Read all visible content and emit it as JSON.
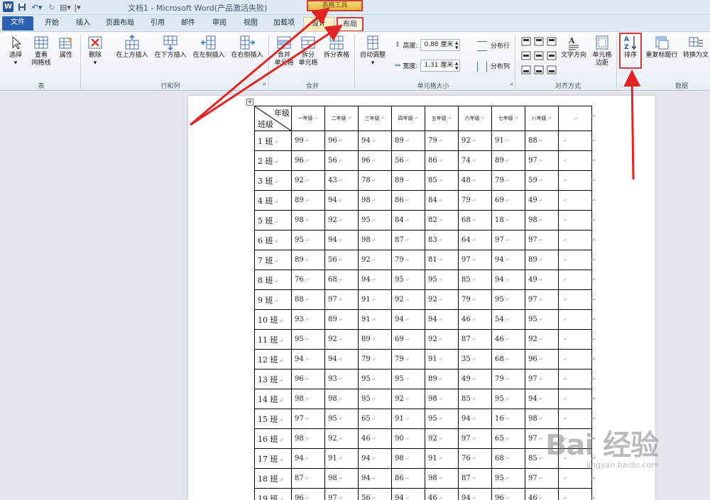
{
  "titlebar": {
    "title": "文档1 - Microsoft Word(产品激活失败)",
    "context_tab_group": "表格工具"
  },
  "tabs": [
    "文件",
    "开始",
    "插入",
    "页面布局",
    "引用",
    "邮件",
    "审阅",
    "视图",
    "加载项",
    "设计",
    "布局"
  ],
  "ribbon": {
    "table_group": {
      "select": "选择",
      "gridlines_line1": "查看",
      "gridlines_line2": "网格线",
      "properties": "属性",
      "label": "表"
    },
    "rows_cols_group": {
      "delete": "删除",
      "insert_above": "在上方插入",
      "insert_below": "在下方插入",
      "insert_left": "在左侧插入",
      "insert_right": "在右侧插入",
      "label": "行和列"
    },
    "merge_group": {
      "merge_line1": "合并",
      "merge_line2": "单元格",
      "split_line1": "拆分",
      "split_line2": "单元格",
      "split_table": "拆分表格",
      "label": "合并"
    },
    "cell_size_group": {
      "autofit": "自动调整",
      "height_label": "高度:",
      "height_value": "0.88 厘米",
      "width_label": "宽度:",
      "width_value": "1.31 厘米",
      "distribute_rows": "分布行",
      "distribute_cols": "分布列",
      "label": "单元格大小"
    },
    "alignment_group": {
      "text_direction": "文字方向",
      "cell_margins_line1": "单元格",
      "cell_margins_line2": "边距",
      "label": "对齐方式"
    },
    "data_group": {
      "sort": "排序",
      "repeat_header": "重复标题行",
      "convert_text": "转换为文",
      "label": "数据"
    }
  },
  "document_table": {
    "header_top": "年级",
    "header_bottom": "班级",
    "columns": [
      "一年级",
      "二年级",
      "三年级",
      "四年级",
      "五年级",
      "六年级",
      "七年级",
      "八年级",
      ""
    ],
    "rows": [
      {
        "name": "1 班",
        "values": [
          "99",
          "96",
          "94",
          "89",
          "79",
          "92",
          "91",
          "88"
        ]
      },
      {
        "name": "2 班",
        "values": [
          "96",
          "56",
          "96",
          "56",
          "86",
          "74",
          "89",
          "97"
        ]
      },
      {
        "name": "3 班",
        "values": [
          "92",
          "43",
          "78",
          "89",
          "85",
          "48",
          "79",
          "59"
        ]
      },
      {
        "name": "4 班",
        "values": [
          "89",
          "94",
          "98",
          "86",
          "84",
          "79",
          "69",
          "49"
        ]
      },
      {
        "name": "5 班",
        "values": [
          "98",
          "92",
          "95",
          "84",
          "82",
          "68",
          "18",
          "98"
        ]
      },
      {
        "name": "6 班",
        "values": [
          "95",
          "94",
          "98",
          "87",
          "83",
          "64",
          "97",
          "97"
        ]
      },
      {
        "name": "7 班",
        "values": [
          "89",
          "56",
          "92",
          "79",
          "81",
          "97",
          "94",
          "89"
        ]
      },
      {
        "name": "8 班",
        "values": [
          "76",
          "68",
          "94",
          "95",
          "95",
          "85",
          "94",
          "49"
        ]
      },
      {
        "name": "9 班",
        "values": [
          "88",
          "97",
          "91",
          "92",
          "92",
          "79",
          "95",
          "97"
        ]
      },
      {
        "name": "10 班",
        "values": [
          "93",
          "89",
          "91",
          "94",
          "94",
          "46",
          "54",
          "95"
        ]
      },
      {
        "name": "11 班",
        "values": [
          "95",
          "92",
          "89",
          "69",
          "92",
          "87",
          "46",
          "92"
        ]
      },
      {
        "name": "12 班",
        "values": [
          "94",
          "94",
          "79",
          "79",
          "91",
          "35",
          "68",
          "96"
        ]
      },
      {
        "name": "13 班",
        "values": [
          "96",
          "93",
          "95",
          "95",
          "89",
          "49",
          "79",
          "97"
        ]
      },
      {
        "name": "14 班",
        "values": [
          "98",
          "98",
          "95",
          "92",
          "98",
          "85",
          "95",
          "94"
        ]
      },
      {
        "name": "15 班",
        "values": [
          "97",
          "95",
          "65",
          "91",
          "95",
          "94",
          "16",
          "98"
        ]
      },
      {
        "name": "16 班",
        "values": [
          "98",
          "92",
          "46",
          "90",
          "92",
          "97",
          "65",
          "97"
        ]
      },
      {
        "name": "17 班",
        "values": [
          "94",
          "91",
          "94",
          "98",
          "91",
          "76",
          "68",
          "85"
        ]
      },
      {
        "name": "18 班",
        "values": [
          "87",
          "98",
          "94",
          "86",
          "98",
          "87",
          "95",
          "97"
        ]
      },
      {
        "name": "19 班",
        "values": [
          "96",
          "97",
          "56",
          "94",
          "46",
          "94",
          "96",
          "46"
        ]
      }
    ]
  },
  "paragraph_mark": "↵",
  "watermark": {
    "main": "Bai 经验",
    "sub": "jingyan.baidu.com"
  },
  "colors": {
    "accent": "#2b579a",
    "highlight": "#d23b3b",
    "context_tab": "#e9b93a"
  }
}
